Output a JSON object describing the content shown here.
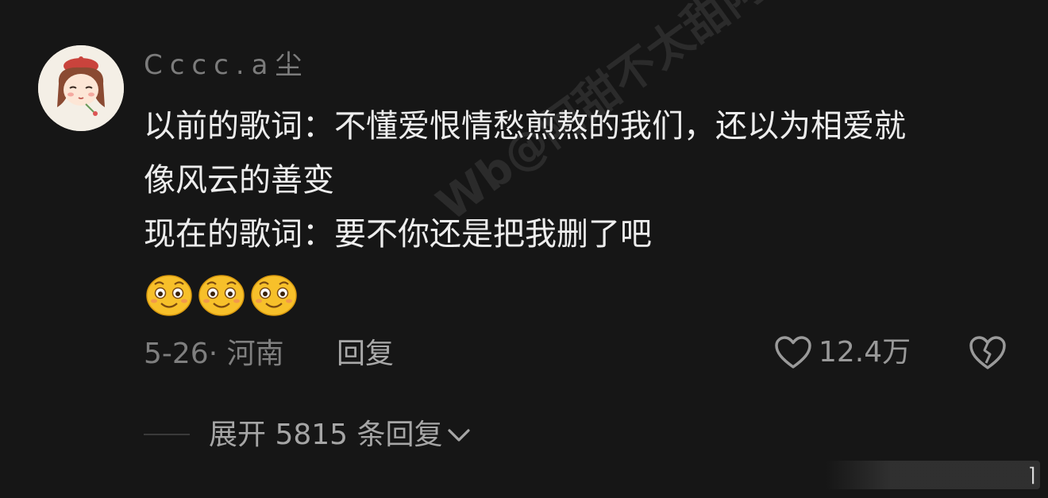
{
  "comment": {
    "username": "Cccc.a尘",
    "lines": [
      "以前的歌词：不懂爱恨情愁煎熬的我们，还以为相爱就",
      "像风云的善变",
      "现在的歌词：要不你还是把我删了吧"
    ],
    "emoji_names": [
      "smiley-emoji",
      "smiley-emoji",
      "smiley-emoji"
    ],
    "meta": "5-26· 河南",
    "reply_label": "回复",
    "like_count": "12.4万",
    "expand_label": "展开 5815 条回复"
  },
  "watermark": "Wb@阿甜不太甜阿",
  "colors": {
    "background": "#161616",
    "text": "#ededed",
    "muted": "#7f7f7f",
    "emoji": "#f7c02a"
  }
}
